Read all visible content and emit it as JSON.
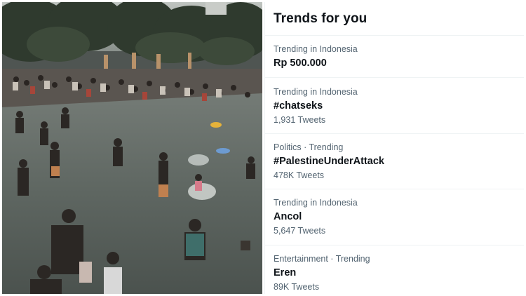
{
  "panel": {
    "title": "Trends for you"
  },
  "trends": [
    {
      "meta": "Trending in Indonesia",
      "name": "Rp 500.000",
      "count": ""
    },
    {
      "meta": "Trending in Indonesia",
      "name": "#chatseks",
      "count": "1,931 Tweets"
    },
    {
      "meta": "Politics · Trending",
      "name": "#PalestineUnderAttack",
      "count": "478K Tweets"
    },
    {
      "meta": "Trending in Indonesia",
      "name": "Ancol",
      "count": "5,647 Tweets"
    },
    {
      "meta": "Entertainment · Trending",
      "name": "Eren",
      "count": "89K Tweets"
    }
  ],
  "colors": {
    "text_primary": "#0f1419",
    "text_secondary": "#536471",
    "divider": "#eff3f4",
    "water": "#5e6661"
  }
}
